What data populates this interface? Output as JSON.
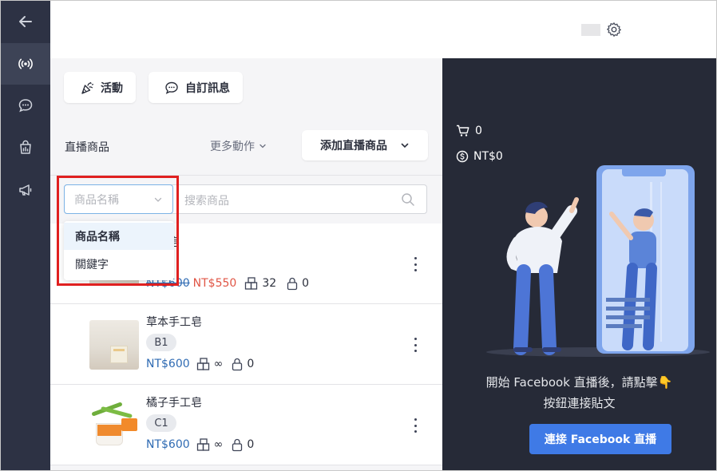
{
  "toolbar": {
    "activity_label": "活動",
    "custom_message_label": "自訂訊息"
  },
  "section": {
    "title": "直播商品",
    "more_actions": "更多動作",
    "add_button": "添加直播商品"
  },
  "search": {
    "select_placeholder": "商品名稱",
    "input_placeholder": "搜索商品",
    "options": [
      "商品名稱",
      "關鍵字"
    ]
  },
  "products": [
    {
      "name_partial": "手工皂",
      "price_old": "NT$600",
      "price_sale": "NT$550",
      "stock": "32",
      "locked": "0"
    },
    {
      "name": "草本手工皂",
      "code": "B1",
      "price": "NT$600",
      "stock": "∞",
      "locked": "0"
    },
    {
      "name": "橘子手工皂",
      "code": "C1",
      "price": "NT$600",
      "stock": "∞",
      "locked": "0"
    }
  ],
  "live": {
    "cart_count": "0",
    "revenue": "NT$0",
    "hint_line1": "開始 Facebook 直播後，請點擊👇",
    "hint_line2": "按鈕連接貼文",
    "connect_button": "連接 Facebook 直播"
  },
  "colors": {
    "nav_bg": "#2d3244",
    "right_panel_bg": "#262a37",
    "price_blue": "#2f6bb3",
    "sale_red": "#e05545",
    "primary_button": "#3f7ae6",
    "highlight_border": "#e02020"
  },
  "icons": {
    "nav": [
      "back-arrow-icon",
      "broadcast-icon",
      "chat-bubble-icon",
      "shopping-bag-icon",
      "megaphone-icon"
    ],
    "top": "gear-icon"
  }
}
